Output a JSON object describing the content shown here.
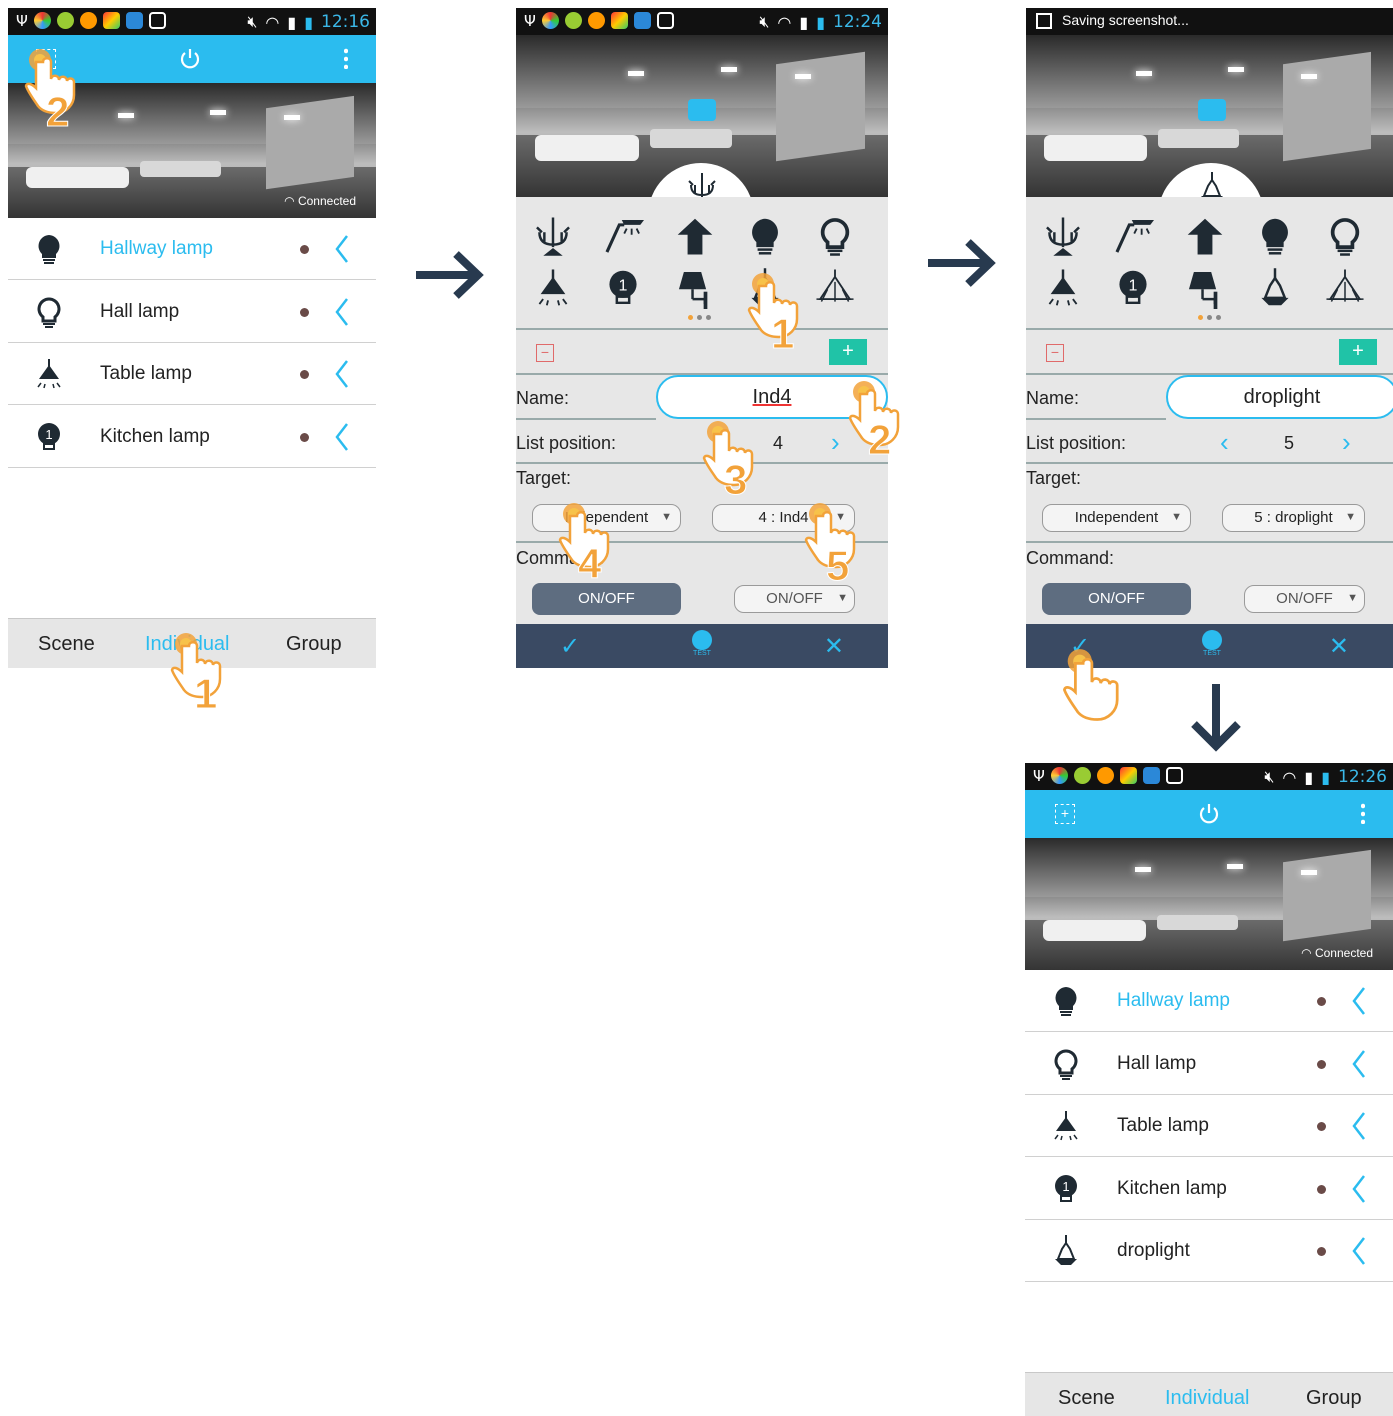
{
  "status_bars": [
    {
      "time": "12:16"
    },
    {
      "time": "12:24"
    },
    {
      "time": "12:26"
    }
  ],
  "saving_text": "Saving screenshot...",
  "connected_label": "Connected",
  "lamp_list_initial": [
    {
      "label": "Hallway lamp",
      "icon": "bulb-icon",
      "active": true
    },
    {
      "label": "Hall lamp",
      "icon": "bulb-outline-icon",
      "active": false
    },
    {
      "label": "Table lamp",
      "icon": "table-lamp-icon",
      "active": false
    },
    {
      "label": "Kitchen lamp",
      "icon": "numbered-bulb-icon",
      "active": false
    }
  ],
  "lamp_list_final": [
    {
      "label": "Hallway lamp",
      "icon": "bulb-icon",
      "active": true
    },
    {
      "label": "Hall lamp",
      "icon": "bulb-outline-icon",
      "active": false
    },
    {
      "label": "Table lamp",
      "icon": "table-lamp-icon",
      "active": false
    },
    {
      "label": "Kitchen lamp",
      "icon": "numbered-bulb-icon",
      "active": false
    },
    {
      "label": "droplight",
      "icon": "droplight-icon",
      "active": false
    }
  ],
  "tabs": [
    {
      "label": "Scene",
      "active": false
    },
    {
      "label": "Individual",
      "active": true
    },
    {
      "label": "Group",
      "active": false
    }
  ],
  "icon_grid": [
    "chandelier-icon",
    "spotlight-icon",
    "up-lamp-icon",
    "bulb-icon",
    "bulb-outline-icon",
    "ceiling-lamp-icon",
    "numbered-bulb-icon",
    "wall-lamp-icon",
    "droplight-icon",
    "crystal-lamp-icon"
  ],
  "badge_number": "1",
  "dialog_a": {
    "name_label": "Name:",
    "name_value": "Ind4",
    "position_label": "List position:",
    "position_value": "4",
    "target_label": "Target:",
    "target_type": "Independent",
    "target_item": "4 : Ind4",
    "command_label": "Command:",
    "command_primary": "ON/OFF",
    "command_secondary": "ON/OFF",
    "test_label": "TEST"
  },
  "dialog_b": {
    "name_label": "Name:",
    "name_value": "droplight",
    "position_label": "List position:",
    "position_value": "5",
    "target_label": "Target:",
    "target_type": "Independent",
    "target_item": "5 : droplight",
    "command_label": "Command:",
    "command_primary": "ON/OFF",
    "command_secondary": "ON/OFF",
    "test_label": "TEST"
  },
  "step_numbers": [
    "2",
    "1",
    "1",
    "2",
    "3",
    "4",
    "5"
  ],
  "colors": {
    "accent": "#2bbcef",
    "dialog_bg": "#e7e7e7",
    "action_bar": "#3a4a63",
    "add": "#20c3a7",
    "remove": "#e06a6a",
    "hand": "#f2a23a"
  }
}
